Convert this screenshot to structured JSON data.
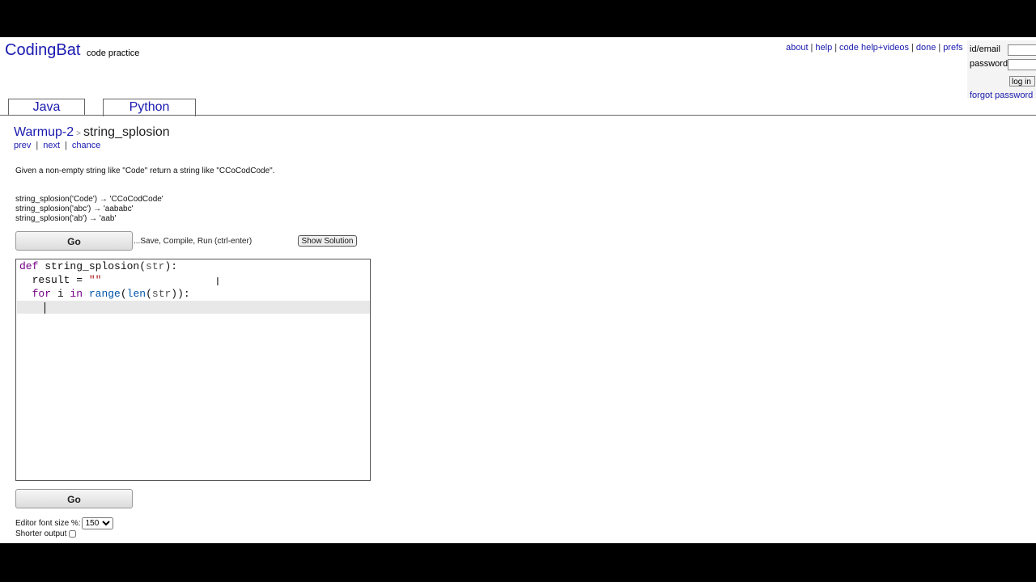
{
  "header": {
    "logo": "CodingBat",
    "logo_sub": "code practice",
    "nav": [
      "about",
      "help",
      "code help+videos",
      "done",
      "prefs"
    ]
  },
  "login": {
    "id_label": "id/email",
    "password_label": "password",
    "button": "log in",
    "forgot": "forgot password"
  },
  "tabs": [
    {
      "label": "Java",
      "active": false
    },
    {
      "label": "Python",
      "active": true
    }
  ],
  "breadcrumb": {
    "parent": "Warmup-2",
    "separator": ">",
    "current": "string_splosion"
  },
  "problem_nav": [
    "prev",
    "next",
    "chance"
  ],
  "problem": {
    "description": "Given a non-empty string like \"Code\" return a string like \"CCoCodCode\".",
    "examples": [
      "string_splosion('Code') → 'CCoCodCode'",
      "string_splosion('abc') → 'aababc'",
      "string_splosion('ab') → 'aab'"
    ]
  },
  "actions": {
    "go": "Go",
    "hint": "...Save, Compile, Run (ctrl-enter)",
    "show_solution": "Show Solution"
  },
  "editor": {
    "lines": [
      "def string_splosion(str):",
      "  result = \"\"",
      "  for i in range(len(str)):",
      "    "
    ]
  },
  "options": {
    "font_size_label": "Editor font size %:",
    "font_size_value": "150",
    "shorter_output_label": "Shorter output"
  },
  "colors": {
    "link": "#1a1ab0",
    "keyword": "#770088",
    "builtin": "#0055aa",
    "string": "#aa1111"
  }
}
